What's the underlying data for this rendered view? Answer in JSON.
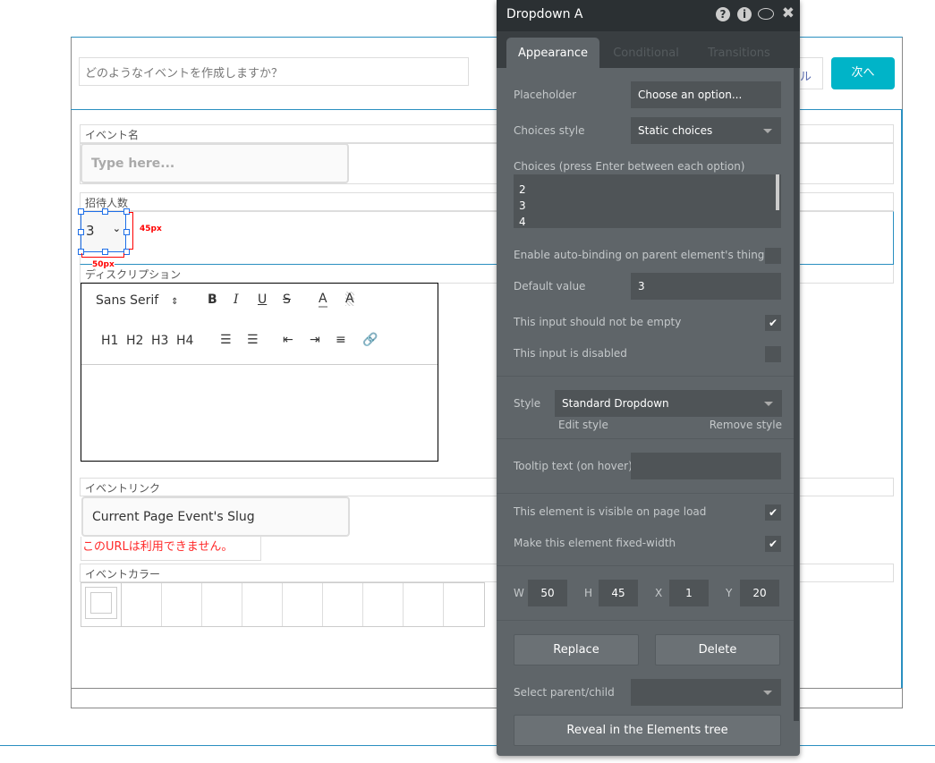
{
  "page": {
    "question_placeholder": "どのようなイベントを作成しますか？",
    "cancel_label_partial": "ル",
    "next_label": "次へ",
    "event_name_label": "イベント名",
    "event_name_placeholder": "Type here...",
    "invitees_label": "招待人数",
    "invitees_value": "3",
    "height_marker": "45px",
    "width_marker": "50px",
    "description_label": "ディスクリプション",
    "editor": {
      "font": "Sans Serif",
      "headings": [
        "H1",
        "H2",
        "H3",
        "H4"
      ]
    },
    "event_link_label": "イベントリンク",
    "event_link_value": "Current Page Event's Slug",
    "url_error": "このURLは利用できません。",
    "event_color_label": "イベントカラー",
    "accent": "#00b4c8",
    "error_color": "#ff2a2a"
  },
  "panel": {
    "title": "Dropdown A",
    "tabs": [
      {
        "label": "Appearance",
        "active": true
      },
      {
        "label": "Conditional"
      },
      {
        "label": "Transitions"
      }
    ],
    "placeholder_label": "Placeholder",
    "placeholder_value": "Choose an option...",
    "choices_style_label": "Choices style",
    "choices_style_value": "Static choices",
    "choices_label": "Choices (press Enter between each option)",
    "choices": [
      "2",
      "3",
      "4"
    ],
    "auto_binding_label": "Enable auto-binding on parent element's thing",
    "auto_binding": false,
    "default_value_label": "Default value",
    "default_value": "3",
    "not_empty_label": "This input should not be empty",
    "not_empty": true,
    "disabled_label": "This input is disabled",
    "disabled": false,
    "style_label": "Style",
    "style_value": "Standard Dropdown",
    "edit_style": "Edit style",
    "remove_style": "Remove style",
    "tooltip_label": "Tooltip text (on hover)",
    "tooltip_value": "",
    "visible_label": "This element is visible on page load",
    "visible": true,
    "fixed_width_label": "Make this element fixed-width",
    "fixed_width": true,
    "w_label": "W",
    "w": "50",
    "h_label": "H",
    "h": "45",
    "x_label": "X",
    "x": "1",
    "y_label": "Y",
    "y": "20",
    "replace": "Replace",
    "delete": "Delete",
    "select_parent_label": "Select parent/child",
    "reveal": "Reveal in the Elements tree"
  }
}
